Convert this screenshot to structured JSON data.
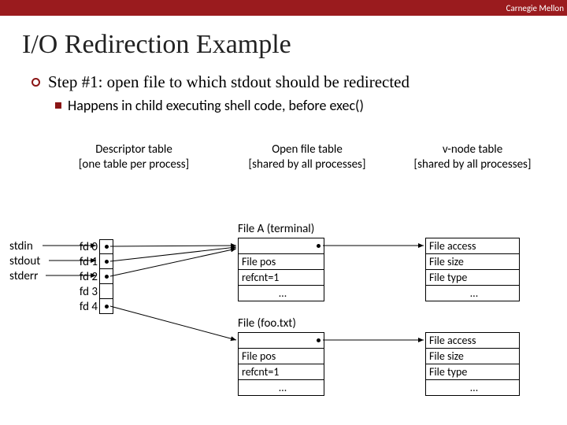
{
  "header": {
    "org": "Carnegie Mellon"
  },
  "title": "I/O Redirection Example",
  "step": {
    "text": "Step #1: open file to which stdout should be redirected",
    "sub": "Happens in child executing shell code, before exec()"
  },
  "labels": {
    "desc1": "Descriptor table",
    "desc2": "[one table per process]",
    "open1": "Open file table",
    "open2": "[shared by all processes]",
    "vnode1": "v-node table",
    "vnode2": "[shared by all processes]"
  },
  "fds": {
    "std": [
      "stdin",
      "stdout",
      "stderr"
    ],
    "rows": [
      "fd 0",
      "fd 1",
      "fd 2",
      "fd 3",
      "fd 4"
    ]
  },
  "fileA": {
    "title": "File A (terminal)",
    "rows": [
      "",
      "File pos",
      "refcnt=1",
      "…"
    ]
  },
  "fileB": {
    "title": "File (foo.txt)",
    "rows": [
      "",
      "File pos",
      "refcnt=1",
      "…"
    ]
  },
  "vnode": {
    "rows": [
      "File access",
      "File size",
      "File type",
      "…"
    ]
  }
}
